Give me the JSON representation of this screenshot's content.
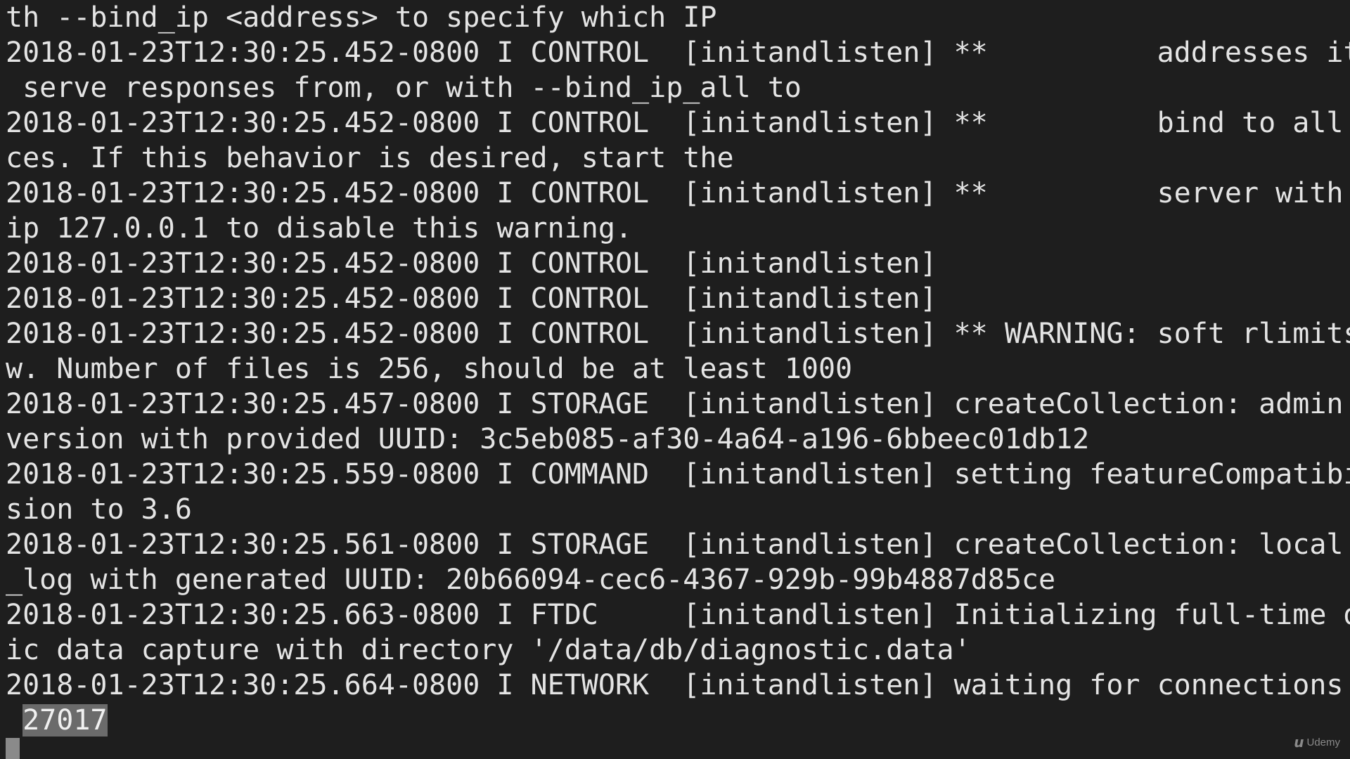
{
  "terminal": {
    "lines": [
      "th --bind_ip <address> to specify which IP",
      "2018-01-23T12:30:25.452-0800 I CONTROL  [initandlisten] **          addresses it should",
      " serve responses from, or with --bind_ip_all to",
      "2018-01-23T12:30:25.452-0800 I CONTROL  [initandlisten] **          bind to all interfa",
      "ces. If this behavior is desired, start the",
      "2018-01-23T12:30:25.452-0800 I CONTROL  [initandlisten] **          server with --bind_",
      "ip 127.0.0.1 to disable this warning.",
      "2018-01-23T12:30:25.452-0800 I CONTROL  [initandlisten]",
      "2018-01-23T12:30:25.452-0800 I CONTROL  [initandlisten]",
      "2018-01-23T12:30:25.452-0800 I CONTROL  [initandlisten] ** WARNING: soft rlimits too lo",
      "w. Number of files is 256, should be at least 1000",
      "2018-01-23T12:30:25.457-0800 I STORAGE  [initandlisten] createCollection: admin.system.",
      "version with provided UUID: 3c5eb085-af30-4a64-a196-6bbeec01db12",
      "2018-01-23T12:30:25.559-0800 I COMMAND  [initandlisten] setting featureCompatibilityVer",
      "sion to 3.6",
      "2018-01-23T12:30:25.561-0800 I STORAGE  [initandlisten] createCollection: local.startup",
      "_log with generated UUID: 20b66094-cec6-4367-929b-99b4887d85ce",
      "2018-01-23T12:30:25.663-0800 I FTDC     [initandlisten] Initializing full-time diagnost",
      "ic data capture with directory '/data/db/diagnostic.data'",
      "2018-01-23T12:30:25.664-0800 I NETWORK  [initandlisten] waiting for connections on port"
    ],
    "last_line_prefix": " ",
    "last_line_selected": "27017"
  },
  "watermark": {
    "text": "Udemy",
    "icon": "udemy-logo-icon"
  },
  "colors": {
    "background": "#1e1e1e",
    "text": "#e4e4e4",
    "selection": "#6b6b6b"
  }
}
